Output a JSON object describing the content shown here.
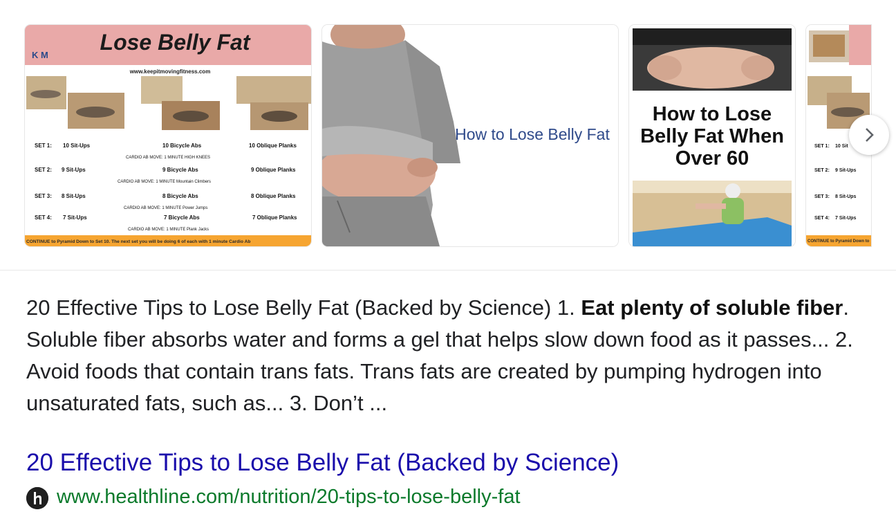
{
  "images": [
    {
      "title": "Lose Belly Fat",
      "logo": "K M",
      "website": "www.keepitmovingfitness.com",
      "sets": [
        {
          "label": "SET 1:",
          "situps": "10 Sit-Ups",
          "bicycle": "10 Bicycle Abs",
          "oblique": "10 Oblique Planks",
          "cardio": "CARDIO AB MOVE: 1 MINUTE  HIGH KNEES"
        },
        {
          "label": "SET 2:",
          "situps": "9 Sit-Ups",
          "bicycle": "9 Bicycle Abs",
          "oblique": "9 Oblique Planks",
          "cardio": "CARDIO AB MOVE: 1 MINUTE  Mountain Climbers"
        },
        {
          "label": "SET 3:",
          "situps": "8 Sit-Ups",
          "bicycle": "8 Bicycle Abs",
          "oblique": "8 Oblique Planks",
          "cardio": "CARDIO AB MOVE: 1 MINUTE  Power Jumps"
        },
        {
          "label": "SET 4:",
          "situps": "7 Sit-Ups",
          "bicycle": "7 Bicycle Abs",
          "oblique": "7 Oblique Planks",
          "cardio": "CARDIO AB MOVE: 1 MINUTE  Plank Jacks"
        }
      ],
      "footer": "CONTINUE to Pyramid Down to Set 10. The next set you will be doing 6 of each with 1 minute Cardio Ab"
    },
    {
      "caption": "How to Lose Belly Fat"
    },
    {
      "heading_lines": [
        "How to Lose",
        "Belly Fat When",
        "Over 60"
      ]
    },
    {
      "sets": [
        {
          "label": "SET 1:",
          "situps": "10 Sit"
        },
        {
          "label": "SET 2:",
          "situps": "9 Sit-Ups"
        },
        {
          "label": "SET 3:",
          "situps": "8 Sit-Ups"
        },
        {
          "label": "SET 4:",
          "situps": "7 Sit-Ups"
        }
      ],
      "footer": "CONTINUE to Pyramid Down to"
    }
  ],
  "snippet": {
    "intro": "20 Effective Tips to Lose Belly Fat (Backed by Science) 1. ",
    "bold": "Eat plenty of soluble fiber",
    "rest": ". Soluble fiber absorbs water and forms a gel that helps slow down food as it passes... 2. Avoid foods that contain trans fats. Trans fats are created by pumping hydrogen into unsaturated fats, such as... 3. Don’t ..."
  },
  "result": {
    "title": "20 Effective Tips to Lose Belly Fat (Backed by Science)",
    "url": "www.healthline.com/nutrition/20-tips-to-lose-belly-fat",
    "favicon_icon": "healthline-h-icon"
  },
  "colors": {
    "link": "#1a0dab",
    "url": "#0b7a2b",
    "text": "#202124",
    "banner_pink": "#e9a9a8",
    "banner_orange": "#f6a531"
  }
}
